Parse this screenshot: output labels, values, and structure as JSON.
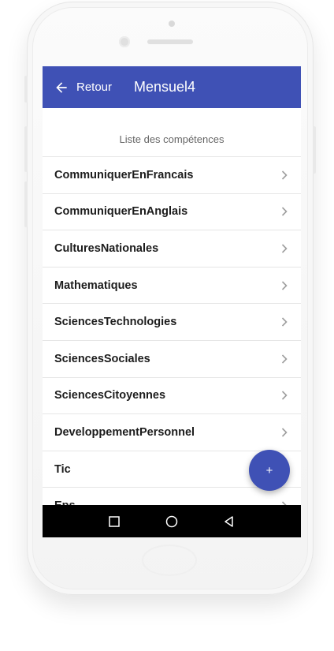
{
  "appbar": {
    "back_label": "Retour",
    "title": "Mensuel4"
  },
  "list_header": "Liste des compétences",
  "items": [
    {
      "label": "CommuniquerEnFrancais"
    },
    {
      "label": "CommuniquerEnAnglais"
    },
    {
      "label": "CulturesNationales"
    },
    {
      "label": "Mathematiques"
    },
    {
      "label": "SciencesTechnologies"
    },
    {
      "label": "SciencesSociales"
    },
    {
      "label": "SciencesCitoyennes"
    },
    {
      "label": "DeveloppementPersonnel"
    },
    {
      "label": "Tic"
    },
    {
      "label": "Eps"
    }
  ],
  "fab": {
    "label": "+"
  },
  "icons": {
    "back": "arrow-left-icon",
    "chevron": "chevron-right-icon",
    "nav_recent": "square-icon",
    "nav_home": "circle-icon",
    "nav_back": "triangle-back-icon"
  },
  "colors": {
    "primary": "#3f51b5",
    "navbar": "#000000",
    "text": "#1c1c1c",
    "subtle": "#666666"
  }
}
